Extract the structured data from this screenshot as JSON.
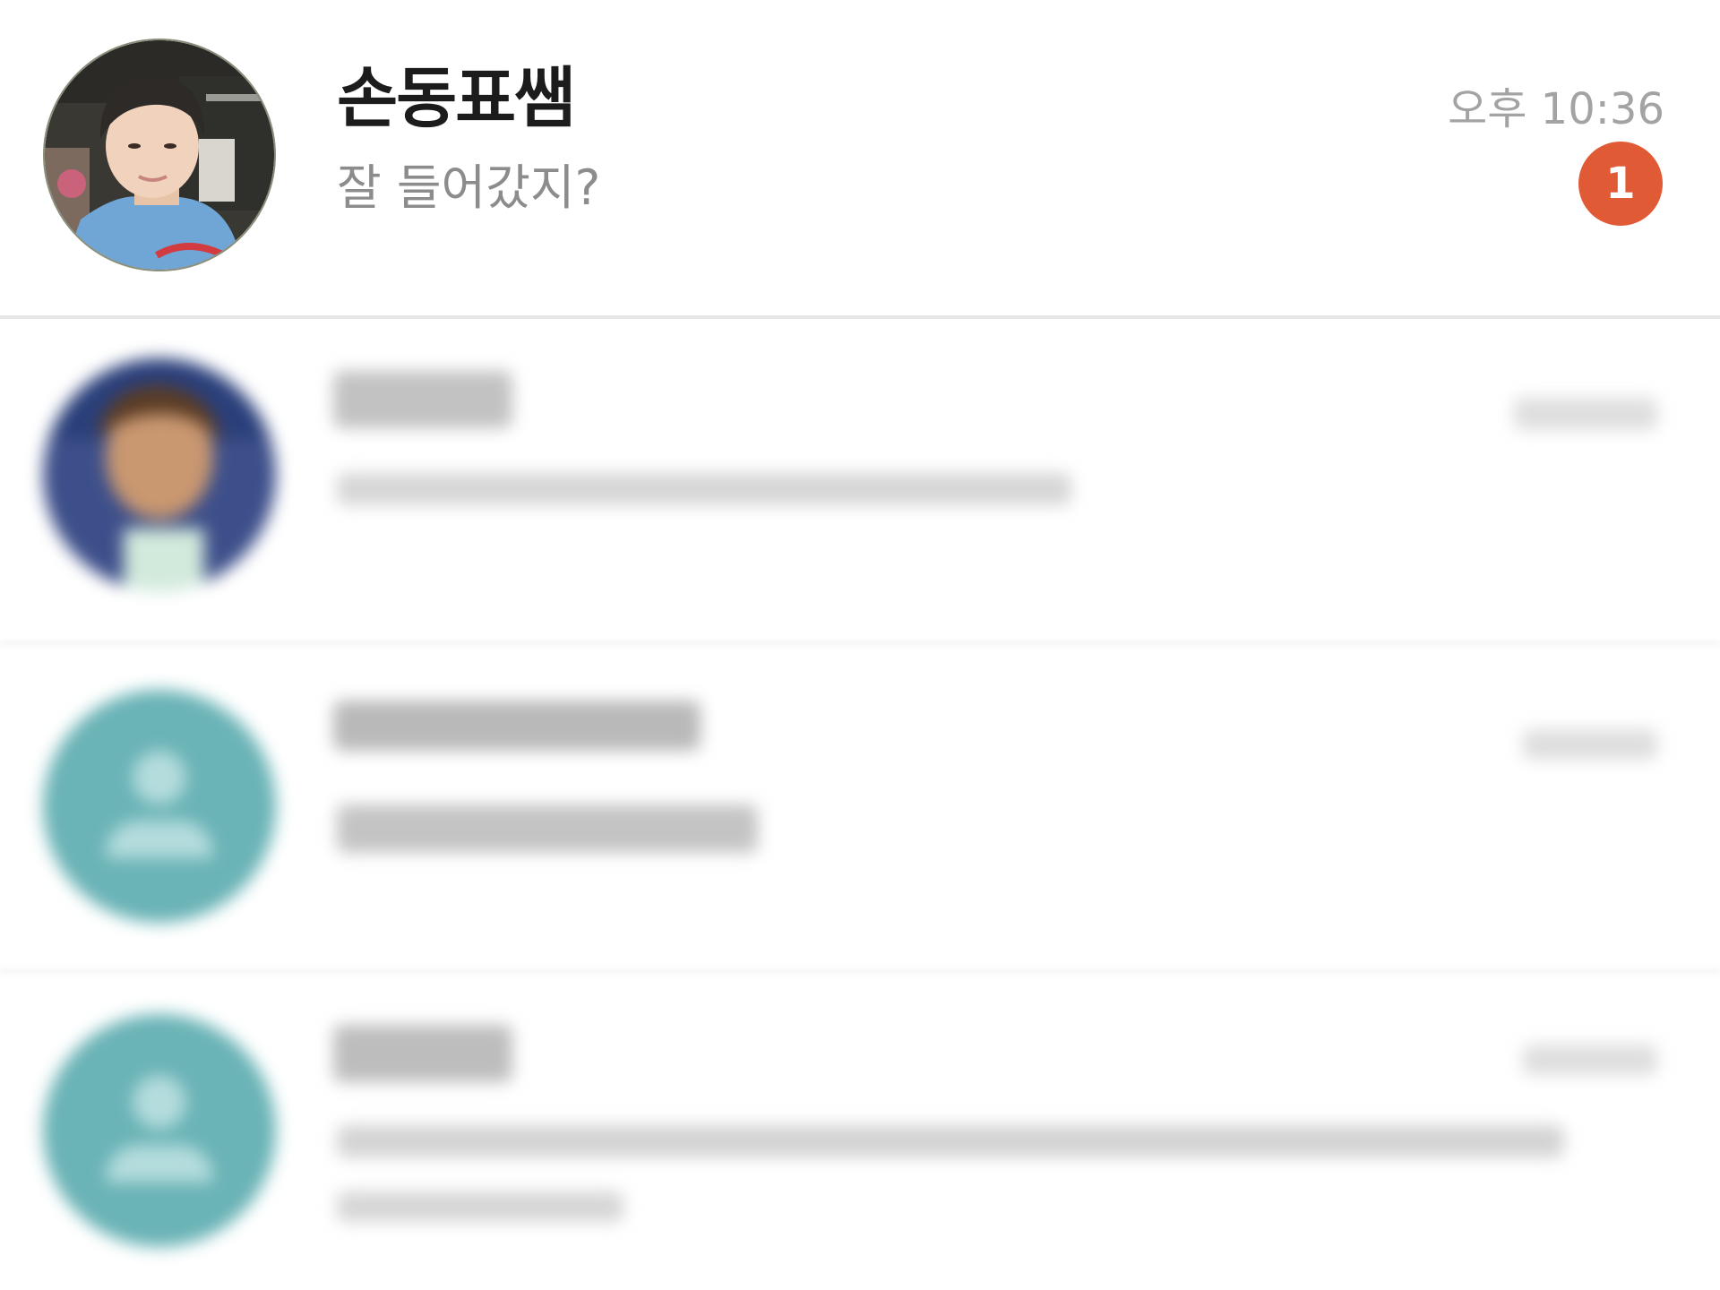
{
  "chat_list": {
    "highlighted": {
      "name": "손동표쌤",
      "preview": "잘 들어갔지?",
      "time": "오후 10:36",
      "unread_count": "1",
      "badge_color": "#e15a36"
    },
    "blurred_rows_count_visible": 3
  },
  "colors": {
    "default_avatar_bg": "#6ab3b6",
    "default_avatar_fg": "#b4dcdd",
    "name_text": "#1c1c1c",
    "preview_text": "#8c8c8c",
    "time_text": "#a3a3a3"
  },
  "icons": {
    "default_avatar": "person-silhouette-icon"
  }
}
